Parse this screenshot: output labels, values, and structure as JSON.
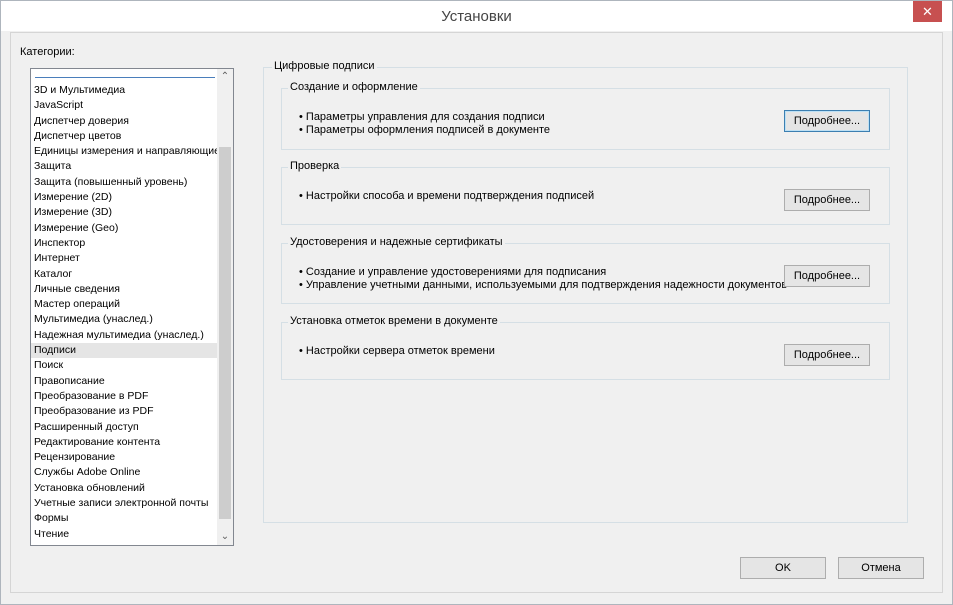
{
  "window": {
    "title": "Установки",
    "close_glyph": "✕"
  },
  "categories": {
    "label": "Категории:",
    "items": [
      "3D и Мультимедиа",
      "JavaScript",
      "Диспетчер доверия",
      "Диспетчер цветов",
      "Единицы измерения и направляющие",
      "Защита",
      "Защита (повышенный уровень)",
      "Измерение (2D)",
      "Измерение (3D)",
      "Измерение (Geo)",
      "Инспектор",
      "Интернет",
      "Каталог",
      "Личные сведения",
      "Мастер операций",
      "Мультимедиа (унаслед.)",
      "Надежная мультимедиа (унаслед.)",
      "Подписи",
      "Поиск",
      "Правописание",
      "Преобразование в PDF",
      "Преобразование из PDF",
      "Расширенный доступ",
      "Редактирование контента",
      "Рецензирование",
      "Службы Adobe Online",
      "Установка обновлений",
      "Учетные записи электронной почты",
      "Формы",
      "Чтение"
    ],
    "selected": "Подписи",
    "scroll_up_glyph": "⌃",
    "scroll_down_glyph": "⌄"
  },
  "main": {
    "title": "Цифровые подписи",
    "sections": [
      {
        "title": "Создание и оформление",
        "bullets": [
          "• Параметры управления для создания подписи",
          "• Параметры оформления подписей в документе"
        ],
        "button": "Подробнее..."
      },
      {
        "title": "Проверка",
        "bullets": [
          "• Настройки способа и времени подтверждения подписей"
        ],
        "button": "Подробнее..."
      },
      {
        "title": "Удостоверения и надежные сертификаты",
        "bullets": [
          "• Создание и управление удостоверениями для подписания",
          "• Управление учетными данными, используемыми для подтверждения надежности документов"
        ],
        "button": "Подробнее..."
      },
      {
        "title": "Установка отметок времени в документе",
        "bullets": [
          "• Настройки сервера отметок времени"
        ],
        "button": "Подробнее..."
      }
    ]
  },
  "footer": {
    "ok": "OK",
    "cancel": "Отмена"
  }
}
